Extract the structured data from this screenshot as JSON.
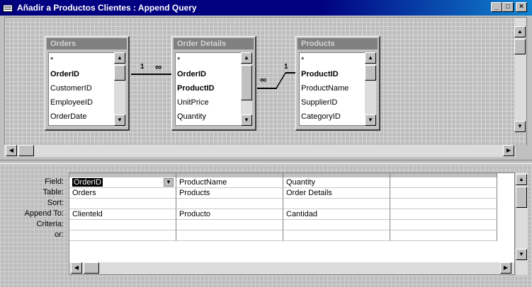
{
  "window": {
    "title": "Añadir a Productos Clientes : Append Query",
    "controls": [
      "minimize-icon",
      "maximize-icon",
      "close-icon"
    ]
  },
  "tables": [
    {
      "name": "Orders",
      "fields": [
        {
          "label": "*",
          "key": false
        },
        {
          "label": "OrderID",
          "key": true
        },
        {
          "label": "CustomerID",
          "key": false
        },
        {
          "label": "EmployeeID",
          "key": false
        },
        {
          "label": "OrderDate",
          "key": false
        }
      ]
    },
    {
      "name": "Order Details",
      "fields": [
        {
          "label": "*",
          "key": false
        },
        {
          "label": "OrderID",
          "key": true
        },
        {
          "label": "ProductID",
          "key": true
        },
        {
          "label": "UnitPrice",
          "key": false
        },
        {
          "label": "Quantity",
          "key": false
        }
      ]
    },
    {
      "name": "Products",
      "fields": [
        {
          "label": "*",
          "key": false
        },
        {
          "label": "ProductID",
          "key": true
        },
        {
          "label": "ProductName",
          "key": false
        },
        {
          "label": "SupplierID",
          "key": false
        },
        {
          "label": "CategoryID",
          "key": false
        }
      ]
    }
  ],
  "relationships": [
    {
      "one": "1",
      "many": "∞"
    },
    {
      "one": "1",
      "many": "∞"
    }
  ],
  "grid": {
    "row_labels": [
      "Field:",
      "Table:",
      "Sort:",
      "Append To:",
      "Criteria:",
      "or:"
    ],
    "columns": [
      {
        "field": "OrderID",
        "table": "Orders",
        "sort": "",
        "append_to": "Clienteld",
        "criteria": "",
        "or": ""
      },
      {
        "field": "ProductName",
        "table": "Products",
        "sort": "",
        "append_to": "Producto",
        "criteria": "",
        "or": ""
      },
      {
        "field": "Quantity",
        "table": "Order Details",
        "sort": "",
        "append_to": "Cantidad",
        "criteria": "",
        "or": ""
      },
      {
        "field": "",
        "table": "",
        "sort": "",
        "append_to": "",
        "criteria": "",
        "or": ""
      }
    ]
  }
}
